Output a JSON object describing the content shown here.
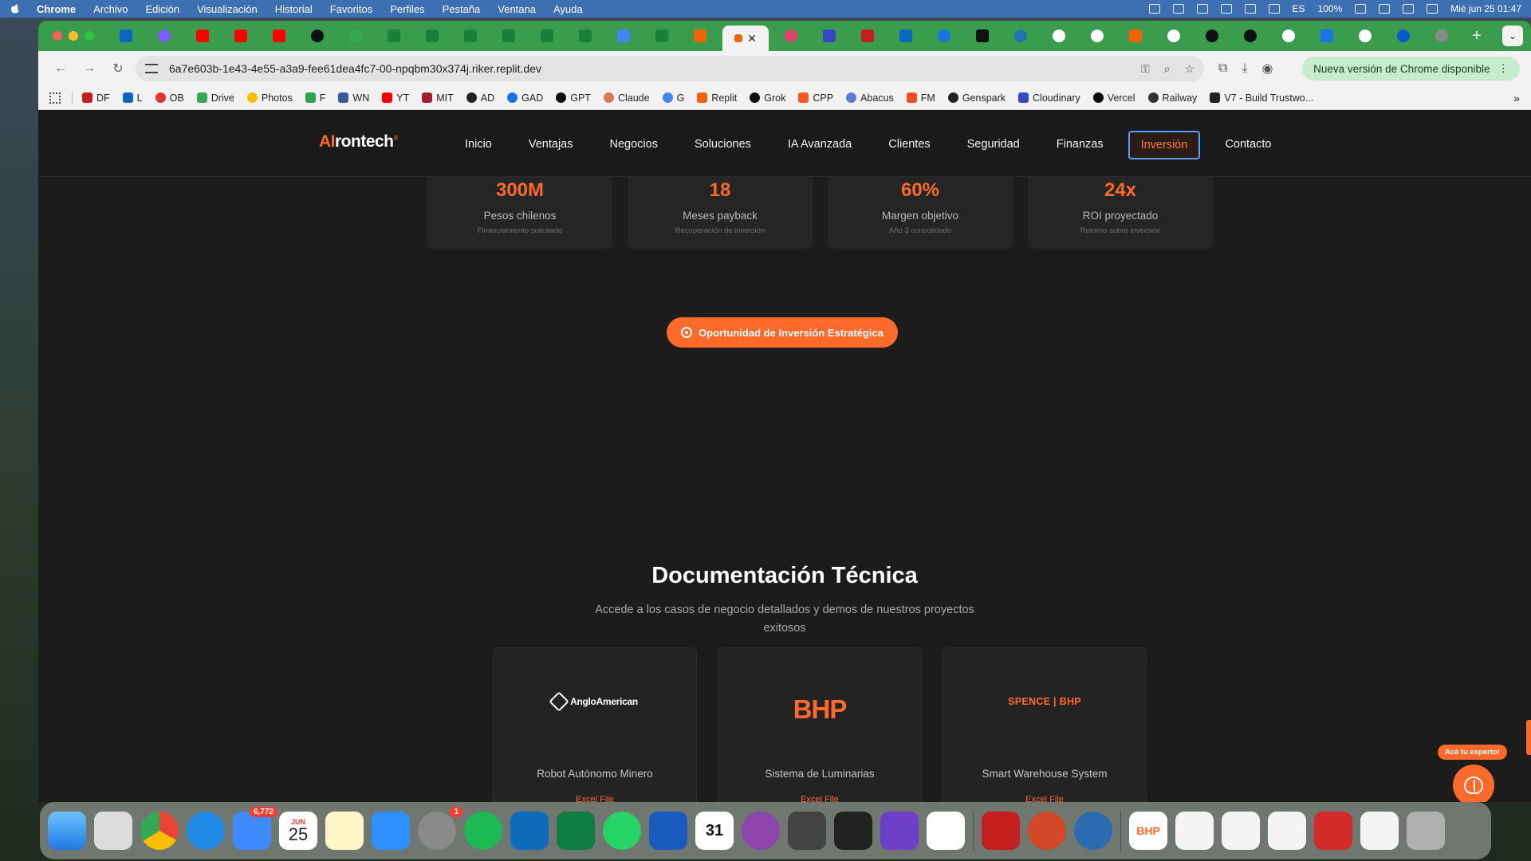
{
  "menubar": {
    "app": "Chrome",
    "items": [
      "Archivo",
      "Edición",
      "Visualización",
      "Historial",
      "Favoritos",
      "Perfiles",
      "Pestaña",
      "Ventana",
      "Ayuda"
    ],
    "input_source": "ES",
    "battery": "100%",
    "datetime": "Mié jun 25  01:47"
  },
  "browser": {
    "url": "6a7e603b-1e43-4e55-a3a9-fee61dea4fc7-00-npqbm30x374j.riker.replit.dev",
    "update_label": "Nueva versión de Chrome disponible",
    "bookmarks": [
      "DF",
      "L",
      "OB",
      "Drive",
      "Photos",
      "F",
      "WN",
      "YT",
      "MIT",
      "AD",
      "GAD",
      "GPT",
      "Claude",
      "G",
      "Replit",
      "Grok",
      "CPP",
      "Abacus",
      "FM",
      "Genspark",
      "Cloudinary",
      "Vercel",
      "Railway",
      "V7 - Build Trustwo..."
    ]
  },
  "site": {
    "logo_ai": "AI",
    "logo_rest": "rontech",
    "logo_sup": "≡",
    "nav": [
      "Inicio",
      "Ventajas",
      "Negocios",
      "Soluciones",
      "IA Avanzada",
      "Clientes",
      "Seguridad",
      "Finanzas",
      "Inversión",
      "Contacto"
    ],
    "active_nav": "Inversión",
    "stats": [
      {
        "value": "300M",
        "label": "Pesos chilenos",
        "sub": "Financiamiento solicitado"
      },
      {
        "value": "18",
        "label": "Meses payback",
        "sub": "Recuperación de inversión"
      },
      {
        "value": "60%",
        "label": "Margen objetivo",
        "sub": "Año 3 consolidado"
      },
      {
        "value": "24x",
        "label": "ROI proyectado",
        "sub": "Retorno sobre inversión"
      }
    ],
    "cta": "Oportunidad de Inversión Estratégica",
    "doc_title": "Documentación Técnica",
    "doc_subtitle": "Accede a los casos de negocio detallados y demos de nuestros proyectos exitosos",
    "doc_cards": [
      {
        "logo": "AngloAmerican",
        "name": "Robot Autónomo Minero",
        "link": "Excel File"
      },
      {
        "logo": "BHP",
        "name": "Sistema de Luminarias",
        "link": "Excel File"
      },
      {
        "logo": "SPENCE | BHP",
        "name": "Smart Warehouse System",
        "link": "Excel File"
      }
    ],
    "chat_label": "Acá tu experto!"
  },
  "dock": {
    "mail_badge": "6,772",
    "calendar_month": "JUN",
    "calendar_day": "25",
    "settings_badge": "1",
    "calendar_app_day": "31",
    "bhp_label": "BHP"
  },
  "colors": {
    "accent": "#ff6a2a",
    "page_bg": "#1c1c1c",
    "active_outline": "#5a9eff"
  }
}
